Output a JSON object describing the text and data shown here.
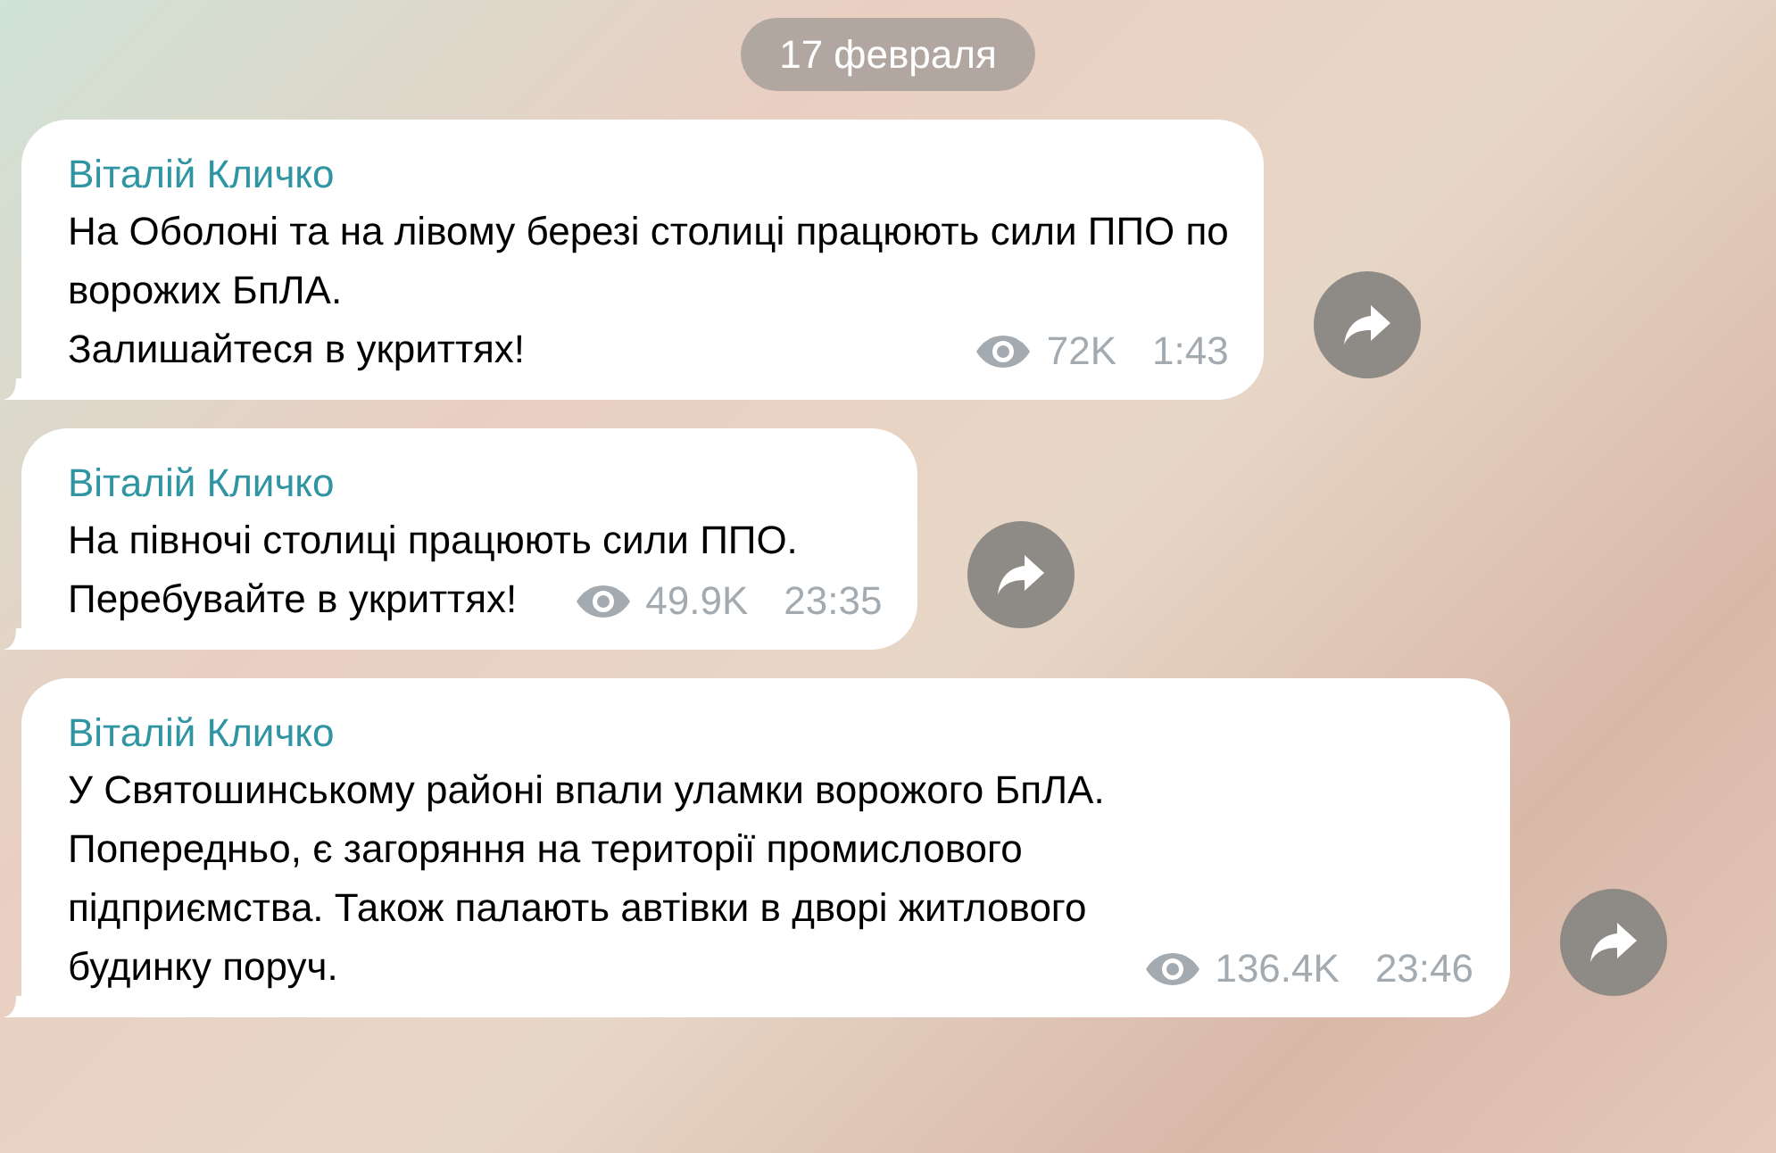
{
  "date": "17 февраля",
  "messages": [
    {
      "author": "Віталій Кличко",
      "paragraphs": [
        "На Оболоні та на лівому березі столиці працюють сили ППО по\nворожих БпЛА.",
        "Залишайтеся в укриттях!"
      ],
      "views": "72K",
      "time": "1:43"
    },
    {
      "author": "Віталій Кличко",
      "paragraphs": [
        "На півночі столиці працюють сили ППО.",
        "Перебувайте в укриттях!"
      ],
      "views": "49.9K",
      "time": "23:35"
    },
    {
      "author": "Віталій Кличко",
      "paragraphs": [
        "У Святошинському районі впали уламки ворожого БпЛА.",
        "Попередньо, є загоряння на території промислового\nпідприємства. Також палають автівки в дворі житлового\nбудинку поруч."
      ],
      "views": "136.4K",
      "time": "23:46"
    }
  ]
}
